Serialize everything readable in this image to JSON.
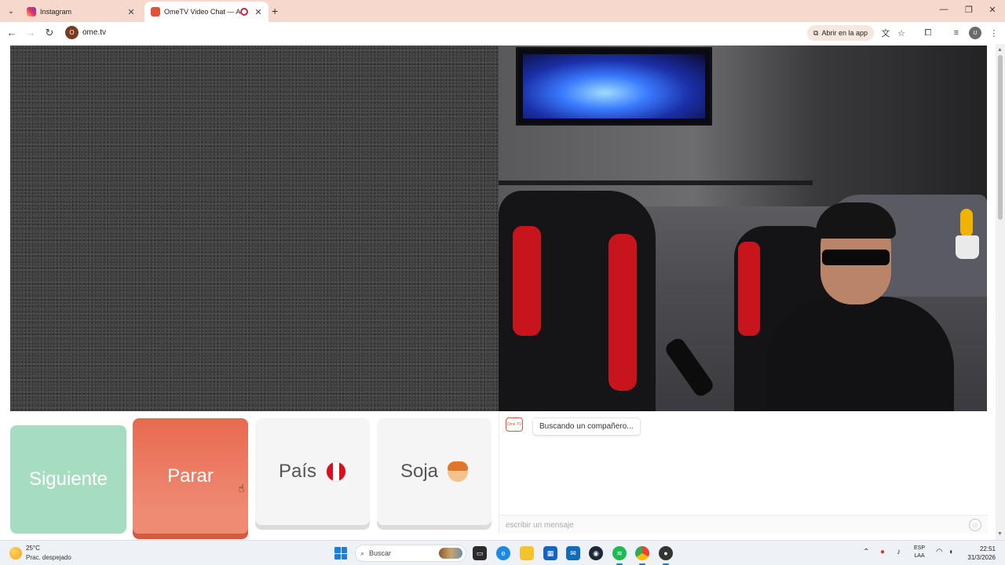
{
  "browser": {
    "tabs": [
      {
        "title": "Instagram",
        "active": false
      },
      {
        "title": "OmeTV Video Chat — Alter",
        "active": true,
        "recording": true
      }
    ],
    "address": "ome.tv",
    "site_badge": "O",
    "open_app_label": "Abrir en la app",
    "profile_initial": "U"
  },
  "app": {
    "buttons": {
      "next": "Siguiente",
      "stop": "Parar",
      "country": "País",
      "gender": "Soja"
    },
    "chat": {
      "logo_text": "Ome TV",
      "status_message": "Buscando un compañero...",
      "input_placeholder": "escribir un mensaje",
      "emoji_symbol": "☺"
    }
  },
  "taskbar": {
    "weather": {
      "temp": "25°C",
      "desc": "Prac. despejado"
    },
    "search_label": "Buscar",
    "language": {
      "line1": "ESP",
      "line2": "LAA"
    },
    "time": "22:51",
    "date": "31/3/2026"
  },
  "colors": {
    "next_button": "#a6dcc0",
    "stop_button": "#e86a50",
    "tab_strip": "#f7d8cc",
    "brand_orange": "#e0523a"
  },
  "icons": {
    "tab_menu": "chevron-down-icon",
    "back": "back-arrow-icon",
    "forward": "forward-arrow-icon",
    "reload": "reload-icon",
    "translate": "translate-icon",
    "bookmark": "star-icon",
    "extensions": "puzzle-icon",
    "media": "media-controls-icon",
    "menu": "kebab-menu-icon",
    "country_flag": "peru-flag-icon",
    "gender": "boy-emoji-icon"
  }
}
